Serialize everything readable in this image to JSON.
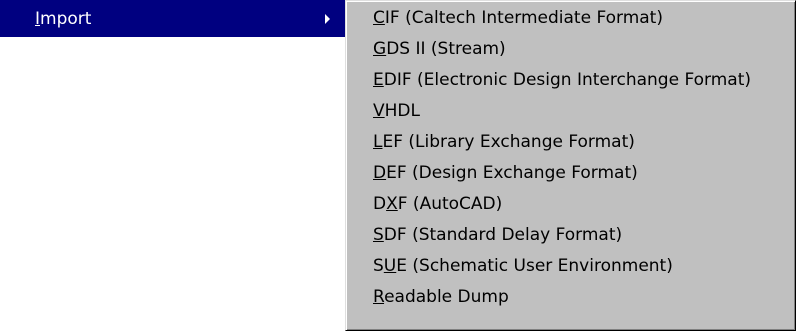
{
  "menu": {
    "parent_item": {
      "label_mnemonic": "I",
      "label_rest": "mport"
    },
    "submenu_items": [
      {
        "pre": "",
        "mn": "C",
        "post": "IF (Caltech Intermediate Format)"
      },
      {
        "pre": "",
        "mn": "G",
        "post": "DS II (Stream)"
      },
      {
        "pre": "",
        "mn": "E",
        "post": "DIF (Electronic Design Interchange Format)"
      },
      {
        "pre": "",
        "mn": "V",
        "post": "HDL"
      },
      {
        "pre": "",
        "mn": "L",
        "post": "EF (Library Exchange Format)"
      },
      {
        "pre": "",
        "mn": "D",
        "post": "EF (Design Exchange Format)"
      },
      {
        "pre": "D",
        "mn": "X",
        "post": "F (AutoCAD)"
      },
      {
        "pre": "",
        "mn": "S",
        "post": "DF (Standard Delay Format)"
      },
      {
        "pre": "S",
        "mn": "U",
        "post": "E (Schematic User Environment)"
      },
      {
        "pre": "",
        "mn": "R",
        "post": "eadable Dump"
      }
    ]
  },
  "colors": {
    "highlight": "#000080",
    "highlight_text": "#ffffff",
    "menu_background": "#c0c0c0",
    "menu_text": "#000000"
  },
  "icons": {
    "submenu_arrow": "triangle-right-icon"
  }
}
